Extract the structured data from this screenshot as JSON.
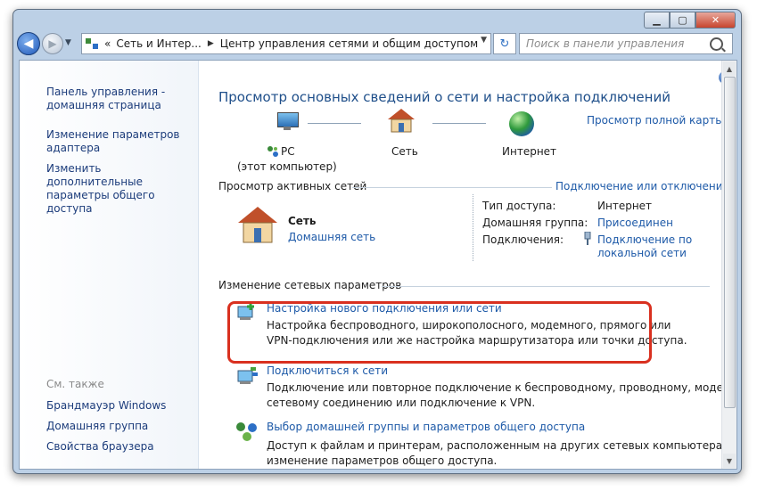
{
  "window": {
    "controls": {
      "minimize": "▁",
      "maximize": "▢",
      "close": "✕"
    }
  },
  "nav": {
    "back_icon": "◀",
    "forward_icon": "▶",
    "recent_icon": "▼",
    "breadcrumb_prefix": "«",
    "breadcrumb": [
      "Сеть и Интер...",
      "Центр управления сетями и общим доступом"
    ],
    "separator": "▶",
    "dropdown_icon": "▼",
    "refresh_icon": "↻",
    "search_placeholder": "Поиск в панели управления"
  },
  "sidebar": {
    "links": [
      "Панель управления - домашняя страница",
      "Изменение параметров адаптера",
      "Изменить дополнительные параметры общего доступа"
    ],
    "see_also_title": "См. также",
    "see_also": [
      "Брандмауэр Windows",
      "Домашняя группа",
      "Свойства браузера"
    ]
  },
  "main": {
    "help_icon": "?",
    "title": "Просмотр основных сведений о сети и настройка подключений",
    "map": {
      "pc_label": "PC",
      "pc_sub": "(этот компьютер)",
      "network_label": "Сеть",
      "internet_label": "Интернет",
      "full_map_link": "Просмотр полной карты"
    },
    "active": {
      "title": "Просмотр активных сетей",
      "connect_link": "Подключение или отключение",
      "network_name": "Сеть",
      "network_type": "Домашняя сеть",
      "access_type_label": "Тип доступа:",
      "access_type_value": "Интернет",
      "homegroup_label": "Домашняя группа:",
      "homegroup_value": "Присоединен",
      "connections_label": "Подключения:",
      "connections_value_1": "Подключение по",
      "connections_value_2": "локальной сети"
    },
    "change": {
      "title": "Изменение сетевых параметров",
      "tasks": [
        {
          "link": "Настройка нового подключения или сети",
          "desc1": "Настройка беспроводного, широкополосного, модемного, прямого или",
          "desc2": "VPN-подключения или же настройка маршрутизатора или точки доступа."
        },
        {
          "link": "Подключиться к сети",
          "desc1": "Подключение или повторное подключение к беспроводному, проводному, модемному",
          "desc2": "сетевому соединению или подключение к VPN."
        },
        {
          "link": "Выбор домашней группы и параметров общего доступа",
          "desc1": "Доступ к файлам и принтерам, расположенным на других сетевых компьютерах, или",
          "desc2": "изменение параметров общего доступа."
        }
      ]
    }
  },
  "colors": {
    "link": "#1e5aa8",
    "title": "#1f4f8a",
    "highlight": "#d9301f"
  }
}
